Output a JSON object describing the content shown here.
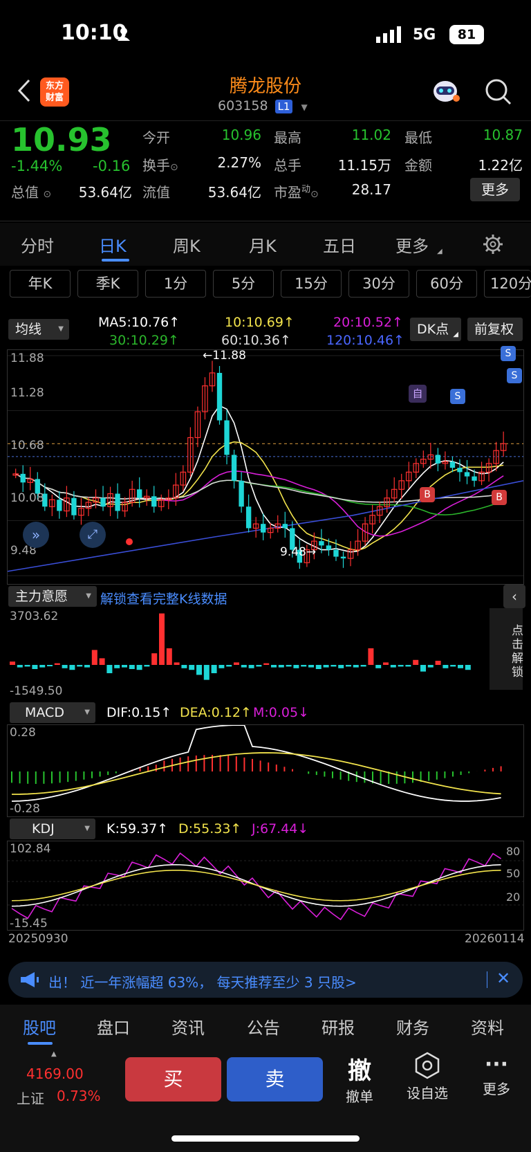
{
  "status": {
    "time": "10:10",
    "network": "5G",
    "battery": "81"
  },
  "header": {
    "name": "腾龙股份",
    "code": "603158",
    "level": "L1",
    "logo_line1": "东方",
    "logo_line2": "财富"
  },
  "quote": {
    "price": "10.93",
    "change_pct": "-1.44%",
    "change": "-0.16",
    "open_label": "今开",
    "open": "10.96",
    "high_label": "最高",
    "high": "11.02",
    "low_label": "最低",
    "low": "10.87",
    "turnover_label": "换手",
    "turnover": "2.27%",
    "volume_label": "总手",
    "volume": "11.15万",
    "amount_label": "金额",
    "amount": "1.22亿",
    "mktcap_label": "总值",
    "mktcap": "53.64亿",
    "float_label": "流值",
    "float": "53.64亿",
    "pe_label": "市盈",
    "pe_sup": "动",
    "pe": "28.17",
    "more": "更多"
  },
  "tabs": [
    "分时",
    "日K",
    "周K",
    "月K",
    "五日",
    "更多"
  ],
  "periods": [
    "年K",
    "季K",
    "1分",
    "5分",
    "15分",
    "30分",
    "60分",
    "120分"
  ],
  "ma": {
    "select": "均线",
    "ma5": "MA5:10.76↑",
    "ma10": "10:10.69↑",
    "ma20": "20:10.52↑",
    "ma30": "30:10.29↑",
    "ma60": "60:10.36↑",
    "ma120": "120:10.46↑",
    "dk": "DK点",
    "fq": "前复权"
  },
  "kline": {
    "y_labels": [
      "11.88",
      "11.28",
      "10.68",
      "10.08",
      "9.48"
    ],
    "high_mark": "11.88",
    "low_mark": "9.48",
    "sig_self": "自",
    "sig_s": "S",
    "sig_b": "B"
  },
  "main_force": {
    "select": "主力意愿",
    "unlock": "解锁查看完整K线数据",
    "max": "3703.62",
    "min": "-1549.50",
    "side_label": "点击解锁"
  },
  "macd": {
    "select": "MACD",
    "dif": "DIF:0.15↑",
    "dea": "DEA:0.12↑",
    "m": "M:0.05↓",
    "max": "0.28",
    "min": "-0.28"
  },
  "kdj": {
    "select": "KDJ",
    "k": "K:59.37↑",
    "d": "D:55.33↑",
    "j": "J:67.44↓",
    "max": "102.84",
    "min": "-15.45",
    "l80": "80",
    "l50": "50",
    "l20": "20",
    "date_start": "20250930",
    "date_end": "20260114"
  },
  "banner": {
    "text": "出！ 近一年涨幅超 63%， 每天推荐至少 3 只股>"
  },
  "bottom_tabs": [
    "股吧",
    "盘口",
    "资讯",
    "公告",
    "研报",
    "财务",
    "资料"
  ],
  "index": {
    "value": "4169.00",
    "name": "上证",
    "pct": "0.73%"
  },
  "actions": {
    "buy": "买",
    "sell": "卖",
    "cancel_big": "撤",
    "cancel": "撤单",
    "watch": "设自选",
    "more": "更多"
  },
  "colors": {
    "up": "#ff3030",
    "down": "#1ed6d6",
    "green": "#27c22e",
    "ma5": "#ffffff",
    "ma10": "#f2e34c",
    "ma20": "#d91fd9",
    "ma30": "#2bb52b",
    "ma60": "#d8d8d8",
    "ma120": "#3a4ed8"
  }
}
